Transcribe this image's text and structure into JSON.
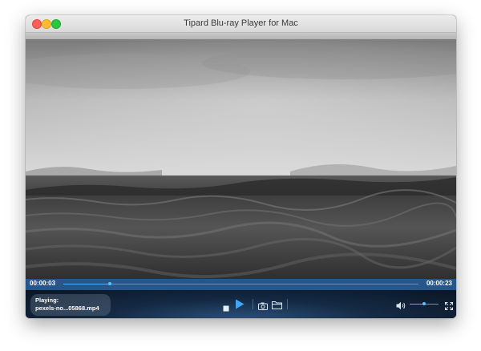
{
  "window": {
    "title": "Tipard Blu-ray Player for Mac"
  },
  "playback": {
    "current_time": "00:00:03",
    "total_time": "00:00:23",
    "progress": 0.13,
    "volume": 0.5
  },
  "now_playing": {
    "label": "Playing:",
    "file": "pexels-no...05868.mp4"
  },
  "icons": {
    "stop": "stop-icon",
    "play": "play-icon",
    "snapshot": "camera-icon",
    "open": "folder-icon",
    "volume": "speaker-icon",
    "fullscreen": "fullscreen-icon"
  },
  "colors": {
    "progress_bar": "#27578a",
    "accent": "#4fb0ff",
    "controls_bg": "#142a44"
  }
}
